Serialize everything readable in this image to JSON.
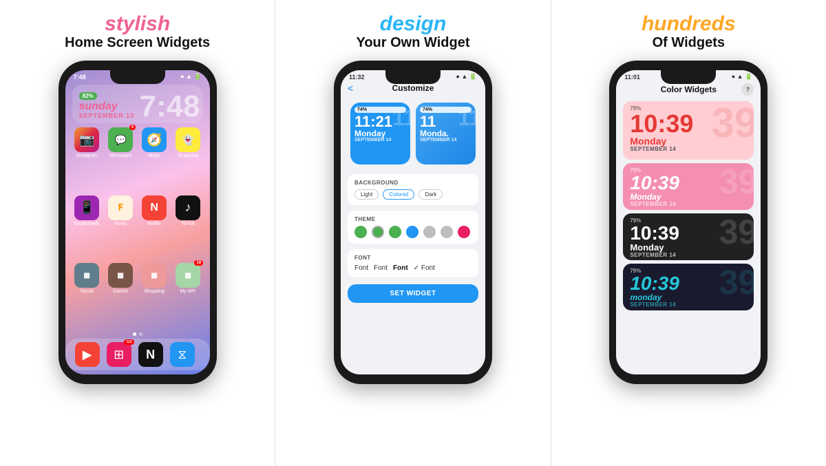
{
  "panels": [
    {
      "id": "panel1",
      "script_text": "stylish",
      "script_color": "#f06292",
      "title_line1": "Home Screen Widgets",
      "phone": {
        "status_time": "7:48",
        "battery": "82%",
        "clock_day": "sunday",
        "clock_big_time": "7:48",
        "clock_date": "SEPTEMBER 13",
        "apps": [
          {
            "label": "Instagram",
            "color": "#e91e63",
            "icon": "📷"
          },
          {
            "label": "Messages",
            "color": "#4caf50",
            "icon": "💬",
            "badge": "5"
          },
          {
            "label": "Maps",
            "color": "#2196f3",
            "icon": "🧭"
          },
          {
            "label": "Snapchat",
            "color": "#ffeb3b",
            "icon": "👻"
          },
          {
            "label": "Social Medi.",
            "color": "#9c27b0",
            "icon": "📱"
          },
          {
            "label": "Fonts",
            "color": "#ff9800",
            "icon": "Ꞙ"
          },
          {
            "label": "Netflix",
            "color": "#f44336",
            "icon": "N"
          },
          {
            "label": "TikTok",
            "color": "#111",
            "icon": "♪"
          },
          {
            "label": "Social",
            "color": "#555",
            "icon": "▦"
          },
          {
            "label": "Games",
            "color": "#607d8b",
            "icon": "▦"
          },
          {
            "label": "Shopping",
            "color": "#795548",
            "icon": "▦"
          },
          {
            "label": "My WP.",
            "color": "#4caf50",
            "icon": "▦",
            "badge": "19"
          }
        ],
        "dock": [
          {
            "color": "#f44336",
            "icon": "▶"
          },
          {
            "color": "#e91e63",
            "icon": "⊞",
            "badge": "123"
          },
          {
            "color": "#111",
            "icon": "N"
          },
          {
            "color": "#2196f3",
            "icon": "⧖"
          }
        ]
      }
    },
    {
      "id": "panel2",
      "script_text": "design",
      "script_color": "#29b6f6",
      "title_line1": "Your Own Widget",
      "phone": {
        "status_time": "11:32",
        "header_title": "Customize",
        "widget1_battery": "74%",
        "widget1_time": "11:21",
        "widget1_day": "Monday",
        "widget1_date": "SEPTEMBER 14",
        "widget2_battery": "74%",
        "widget2_time": "11",
        "widget2_day": "Monda.",
        "widget2_date": "SEPTEMBER 14",
        "bg_options": [
          "Light",
          "Colored",
          "Dark"
        ],
        "bg_selected": "Colored",
        "theme_colors": [
          "#4caf50",
          "#4caf50",
          "#4caf50",
          "#2196f3",
          "#9e9e9e",
          "#9e9e9e",
          "#e91e63"
        ],
        "theme_selected_index": 3,
        "font_options": [
          "Font",
          "Font",
          "Font",
          "✓ Font"
        ],
        "font_styles": [
          "light",
          "normal",
          "bold",
          "check"
        ],
        "set_widget_label": "SET WIDGET",
        "section_bg": "BACKGROUND",
        "section_theme": "THEME",
        "section_font": "FONT"
      }
    },
    {
      "id": "panel3",
      "script_text": "hundreds",
      "script_color": "#ffa726",
      "title_line1": "Of Widgets",
      "phone": {
        "status_time": "11:01",
        "header_title": "Color Widgets",
        "widgets": [
          {
            "battery": "79%",
            "time": "10:39",
            "day": "Monday",
            "date": "SEPTEMBER 14",
            "style": "light-red",
            "height": "large"
          },
          {
            "battery": "79%",
            "time": "10:39",
            "day": "Monday",
            "date": "SEPTEMBER 14",
            "style": "pink-italic"
          },
          {
            "battery": "79%",
            "time": "10:39",
            "day": "Monday",
            "date": "SEPTEMBER 14",
            "style": "dark-white"
          },
          {
            "battery": "79%",
            "time": "10:39",
            "day": "monday",
            "date": "SEPTEMBER 14",
            "style": "black-teal"
          }
        ]
      }
    }
  ]
}
